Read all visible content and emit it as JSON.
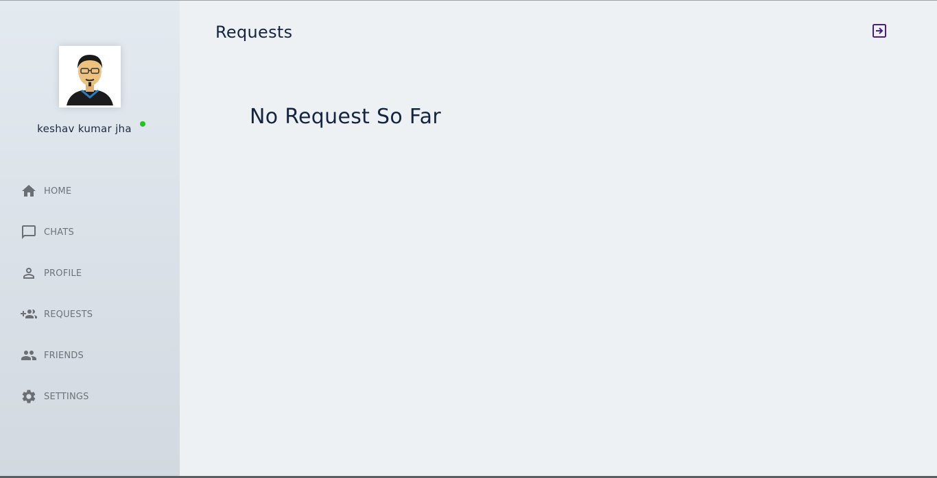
{
  "sidebar": {
    "user": {
      "name": "keshav kumar jha",
      "status_color": "#1fc61f"
    },
    "items": [
      {
        "label": "HOME",
        "icon": "home-icon"
      },
      {
        "label": "CHATS",
        "icon": "chat-bubble-icon"
      },
      {
        "label": "PROFILE",
        "icon": "person-icon"
      },
      {
        "label": "REQUESTS",
        "icon": "group-add-icon"
      },
      {
        "label": "FRIENDS",
        "icon": "people-icon"
      },
      {
        "label": "SETTINGS",
        "icon": "gear-icon"
      }
    ]
  },
  "header": {
    "title": "Requests",
    "logout_icon": "logout-icon",
    "accent": "#4a1a8c"
  },
  "main": {
    "empty_message": "No Request So Far"
  }
}
